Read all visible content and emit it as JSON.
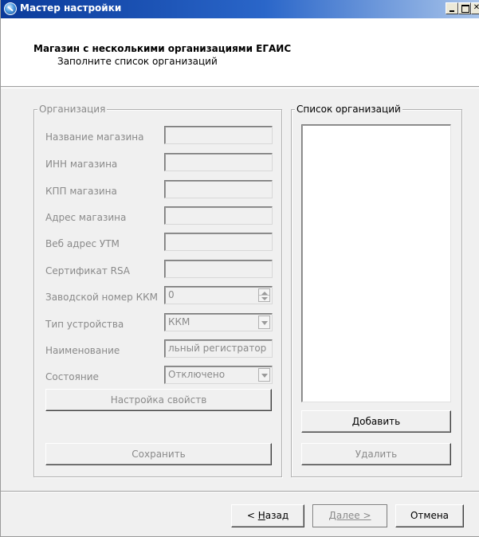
{
  "window": {
    "title": "Мастер настройки"
  },
  "header": {
    "title": "Магазин с несколькими организациями ЕГАИС",
    "subtitle": "Заполните список организаций"
  },
  "org_group": {
    "legend": "Организация",
    "fields": [
      {
        "label": "Название магазина",
        "value": ""
      },
      {
        "label": "ИНН магазина",
        "value": ""
      },
      {
        "label": "КПП магазина",
        "value": ""
      },
      {
        "label": "Адрес магазина",
        "value": ""
      },
      {
        "label": "Веб адрес УТМ",
        "value": ""
      },
      {
        "label": "Сертификат RSA",
        "value": ""
      },
      {
        "label": "Заводской номер ККМ",
        "value": "0"
      },
      {
        "label": "Тип устройства",
        "value": "ККМ"
      },
      {
        "label": "Наименование",
        "value": "льный регистратор"
      },
      {
        "label": "Состояние",
        "value": "Отключено"
      }
    ],
    "props_button": "Настройка свойств",
    "save_button": "Сохранить"
  },
  "list_group": {
    "legend": "Список организаций",
    "items": [],
    "add_button": "Добавить",
    "delete_button": "Удалить"
  },
  "footer": {
    "back_button_prefix": "< ",
    "back_button_mnemonic": "Н",
    "back_button_rest": "азад",
    "next_button": "Далее >",
    "cancel_button": "Отмена"
  }
}
